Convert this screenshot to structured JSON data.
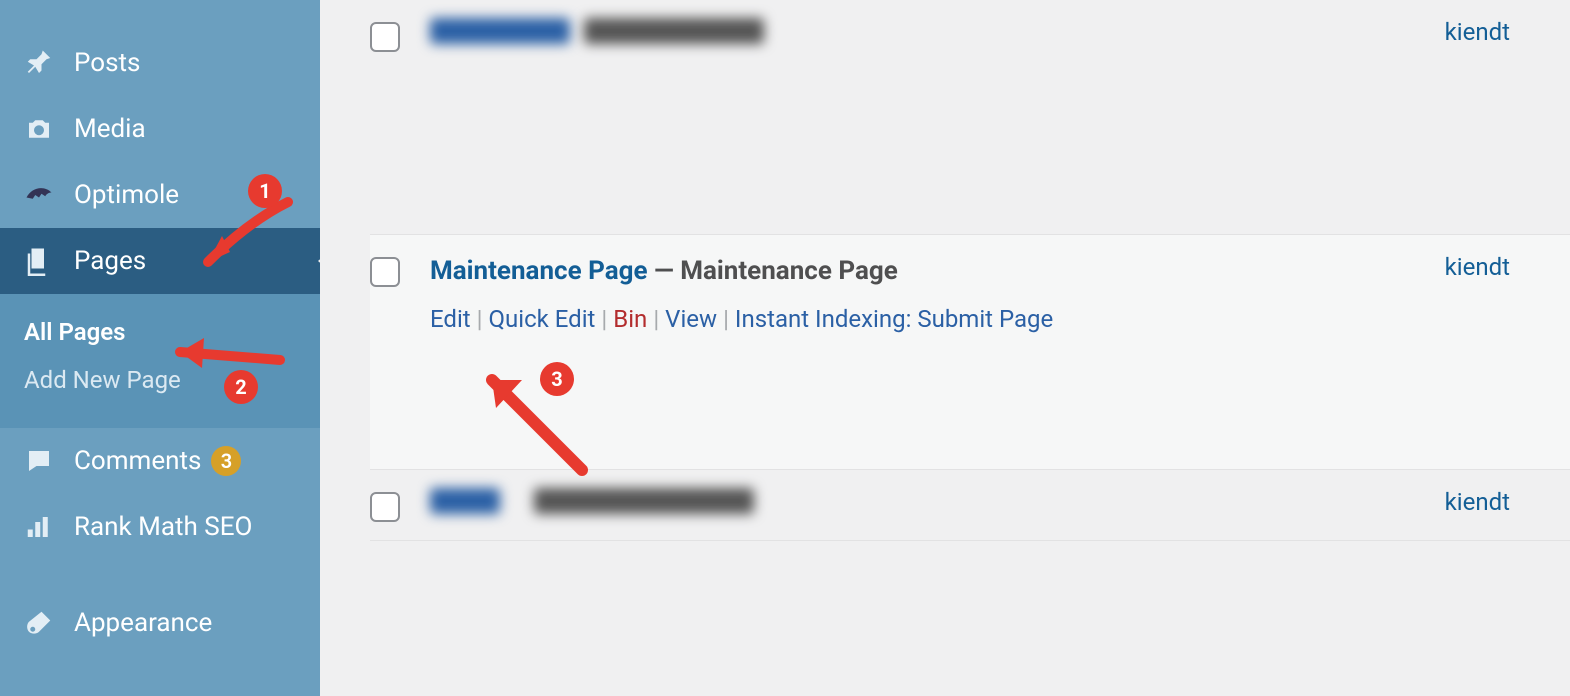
{
  "sidebar": {
    "items": [
      {
        "label": "Posts",
        "icon": "pin-icon"
      },
      {
        "label": "Media",
        "icon": "camera-icon"
      },
      {
        "label": "Optimole",
        "icon": "shark-icon"
      },
      {
        "label": "Pages",
        "icon": "pages-icon",
        "active": true
      },
      {
        "label": "Comments",
        "icon": "comment-icon",
        "badge": "3"
      },
      {
        "label": "Rank Math SEO",
        "icon": "chart-icon"
      },
      {
        "label": "Appearance",
        "icon": "brush-icon"
      }
    ],
    "submenu": {
      "items": [
        {
          "label": "All Pages",
          "current": true
        },
        {
          "label": "Add New Page"
        }
      ]
    }
  },
  "pages": {
    "rows": [
      {
        "author": "kiendt",
        "blurred": true
      },
      {
        "title_link": "Maintenance Page",
        "title_suffix": " — Maintenance Page",
        "author": "kiendt",
        "actions": {
          "edit": "Edit",
          "quick_edit": "Quick Edit",
          "bin": "Bin",
          "view": "View",
          "instant": "Instant Indexing: Submit Page"
        }
      },
      {
        "author": "kiendt",
        "blurred": true
      }
    ]
  },
  "annotations": {
    "b1": "1",
    "b2": "2",
    "b3": "3"
  }
}
